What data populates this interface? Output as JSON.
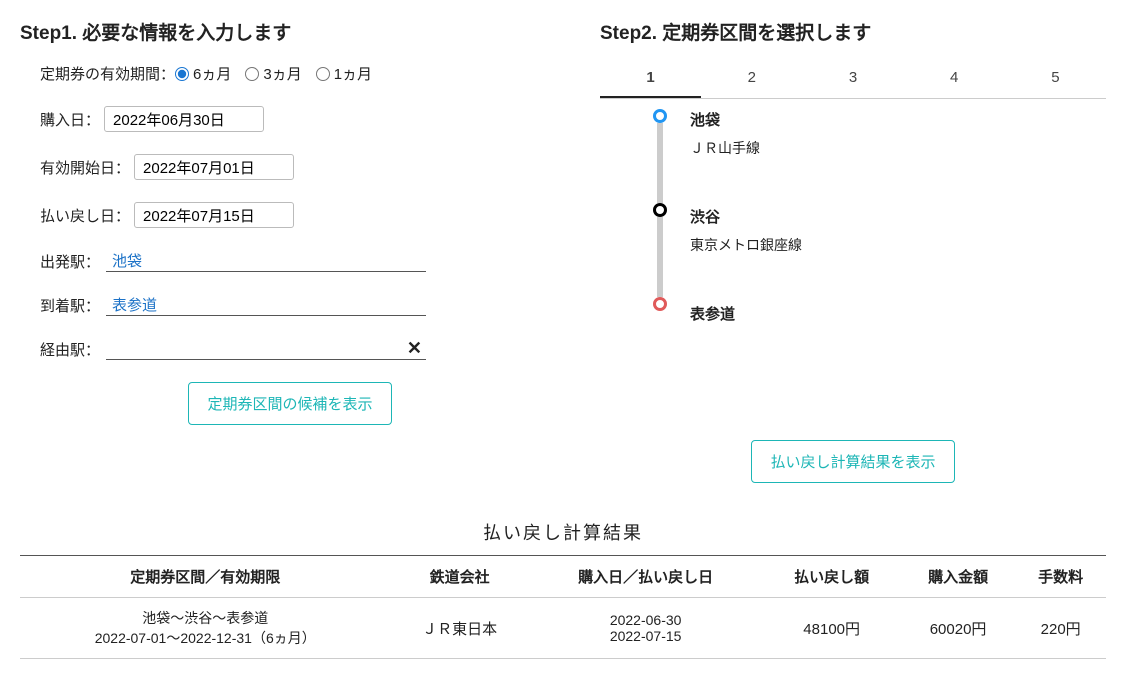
{
  "step1": {
    "heading": "Step1. 必要な情報を入力します",
    "validity_label": "定期券の有効期間：",
    "validity_options": [
      "6ヵ月",
      "3ヵ月",
      "1ヵ月"
    ],
    "validity_selected": "6ヵ月",
    "purchase_label": "購入日：",
    "purchase_value": "2022年06月30日",
    "start_label": "有効開始日：",
    "start_value": "2022年07月01日",
    "refund_label": "払い戻し日：",
    "refund_value": "2022年07月15日",
    "dep_label": "出発駅：",
    "dep_value": "池袋",
    "arr_label": "到着駅：",
    "arr_value": "表参道",
    "via_label": "経由駅：",
    "via_value": "",
    "button": "定期券区間の候補を表示"
  },
  "step2": {
    "heading": "Step2. 定期券区間を選択します",
    "tabs": [
      "1",
      "2",
      "3",
      "4",
      "5"
    ],
    "active_tab": "1",
    "route": [
      {
        "station": "池袋",
        "line": "ＪＲ山手線",
        "pos": "start"
      },
      {
        "station": "渋谷",
        "line": "東京メトロ銀座線",
        "pos": "mid"
      },
      {
        "station": "表参道",
        "line": "",
        "pos": "end"
      }
    ],
    "button": "払い戻し計算結果を表示"
  },
  "results": {
    "title": "払い戻し計算結果",
    "headers": [
      "定期券区間／有効期限",
      "鉄道会社",
      "購入日／払い戻し日",
      "払い戻し額",
      "購入金額",
      "手数料"
    ],
    "row": {
      "section_line1": "池袋〜渋谷〜表参道",
      "section_line2": "2022-07-01〜2022-12-31（6ヵ月）",
      "company": "ＪＲ東日本",
      "buy_date": "2022-06-30",
      "refund_date": "2022-07-15",
      "refund_amount": "48100円",
      "purchase_amount": "60020円",
      "fee": "220円"
    }
  }
}
